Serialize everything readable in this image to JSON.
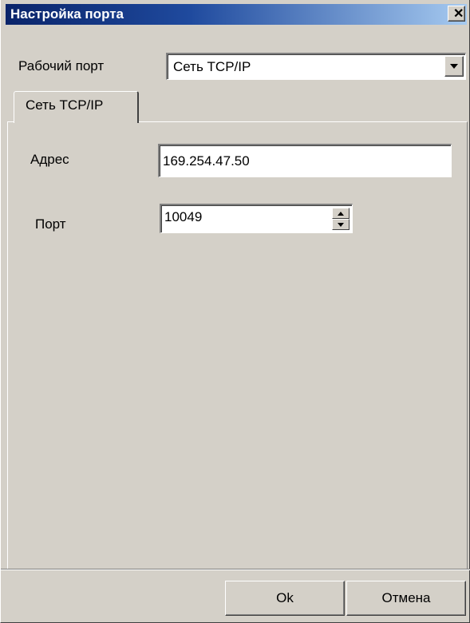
{
  "window": {
    "title": "Настройка порта",
    "close_symbol": "✕"
  },
  "port_selector": {
    "label": "Рабочий порт",
    "selected_value": "Сеть TCP/IP"
  },
  "tabs": [
    {
      "label": "Сеть TCP/IP",
      "active": true
    }
  ],
  "network": {
    "address_label": "Адрес",
    "address_value": "169.254.47.50",
    "port_label": "Порт",
    "port_value": "10049"
  },
  "buttons": {
    "ok_label": "Ok",
    "cancel_label": "Отмена"
  },
  "icons": {
    "close": "close-icon",
    "dropdown": "chevron-down-icon",
    "spin_up": "arrow-up-icon",
    "spin_down": "arrow-down-icon"
  },
  "colors": {
    "titlebar_start": "#0a246a",
    "titlebar_end": "#a6caf0",
    "dialog_face": "#d4d0c8"
  }
}
